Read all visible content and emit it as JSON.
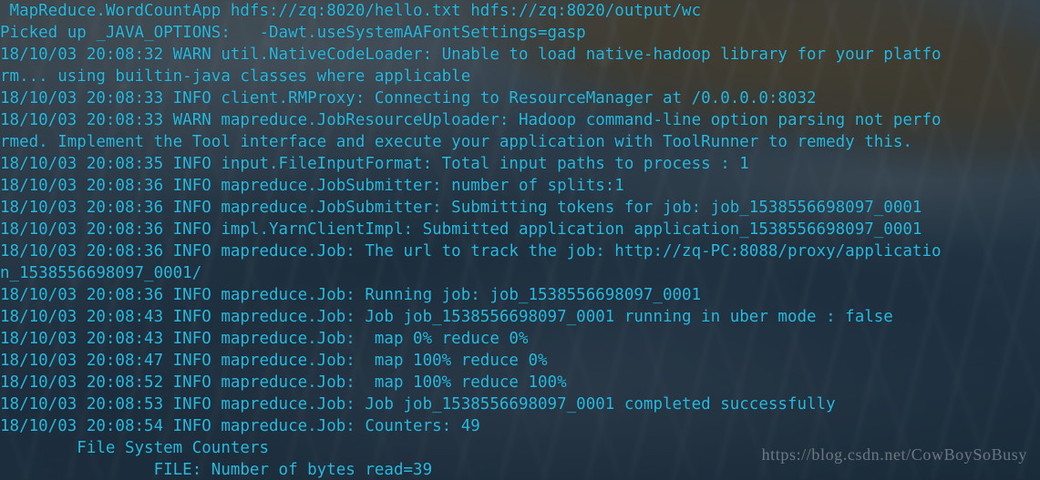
{
  "terminal": {
    "text_color": "#2ab9de",
    "watermark": "https://blog.csdn.net/CowBoySoBusy",
    "lines": [
      " MapReduce.WordCountApp hdfs://zq:8020/hello.txt hdfs://zq:8020/output/wc",
      "Picked up _JAVA_OPTIONS:   -Dawt.useSystemAAFontSettings=gasp",
      "18/10/03 20:08:32 WARN util.NativeCodeLoader: Unable to load native-hadoop library for your platfo",
      "rm... using builtin-java classes where applicable",
      "18/10/03 20:08:33 INFO client.RMProxy: Connecting to ResourceManager at /0.0.0.0:8032",
      "18/10/03 20:08:33 WARN mapreduce.JobResourceUploader: Hadoop command-line option parsing not perfo",
      "rmed. Implement the Tool interface and execute your application with ToolRunner to remedy this.",
      "18/10/03 20:08:35 INFO input.FileInputFormat: Total input paths to process : 1",
      "18/10/03 20:08:36 INFO mapreduce.JobSubmitter: number of splits:1",
      "18/10/03 20:08:36 INFO mapreduce.JobSubmitter: Submitting tokens for job: job_1538556698097_0001",
      "18/10/03 20:08:36 INFO impl.YarnClientImpl: Submitted application application_1538556698097_0001",
      "18/10/03 20:08:36 INFO mapreduce.Job: The url to track the job: http://zq-PC:8088/proxy/applicatio",
      "n_1538556698097_0001/",
      "18/10/03 20:08:36 INFO mapreduce.Job: Running job: job_1538556698097_0001",
      "18/10/03 20:08:43 INFO mapreduce.Job: Job job_1538556698097_0001 running in uber mode : false",
      "18/10/03 20:08:43 INFO mapreduce.Job:  map 0% reduce 0%",
      "18/10/03 20:08:47 INFO mapreduce.Job:  map 100% reduce 0%",
      "18/10/03 20:08:52 INFO mapreduce.Job:  map 100% reduce 100%",
      "18/10/03 20:08:53 INFO mapreduce.Job: Job job_1538556698097_0001 completed successfully",
      "18/10/03 20:08:54 INFO mapreduce.Job: Counters: 49",
      "        File System Counters",
      "                FILE: Number of bytes read=39"
    ]
  }
}
